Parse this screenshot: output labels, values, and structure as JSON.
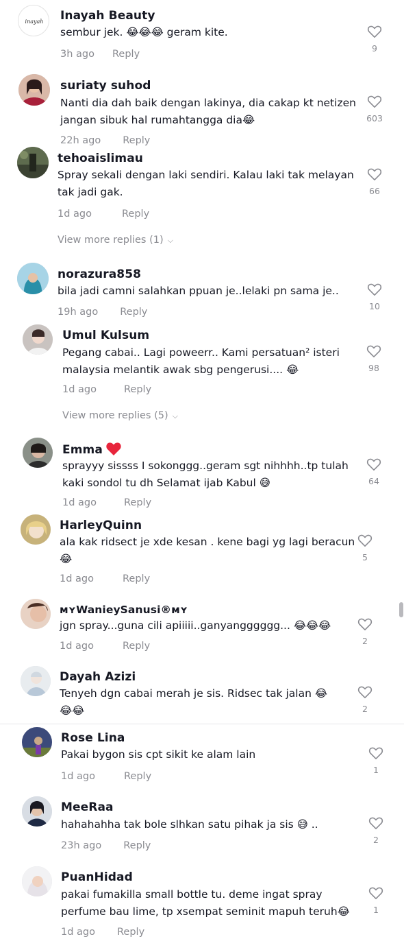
{
  "like_color": "#8a8b91",
  "accent_heart": "#e8253c",
  "comments": [
    {
      "user": "Inayah Beauty",
      "text": "sembur jek. 😂😂😂 geram kite.",
      "time": "3h ago",
      "reply": "Reply",
      "likes": "9"
    },
    {
      "user": "suriaty suhod",
      "text": "Nanti dia dah baik dengan lakinya, dia cakap kt netizen jangan sibuk hal rumahtangga dia😂",
      "time": "22h ago",
      "reply": "Reply",
      "likes": "603"
    },
    {
      "user": "tehoaislimau",
      "text": "Spray sekali dengan laki sendiri. Kalau laki tak melayan tak jadi gak.",
      "time": "1d ago",
      "reply": "Reply",
      "likes": "66",
      "view_more": "View more replies (1)"
    },
    {
      "user": "norazura858",
      "text": "bila jadi camni salahkan ppuan je..lelaki pn sama je..",
      "time": "19h ago",
      "reply": "Reply",
      "likes": "10"
    },
    {
      "user": "Umul Kulsum",
      "text": "Pegang cabai.. Lagi poweerr.. Kami persatuan² isteri malaysia melantik awak sbg pengerusi.... 😂",
      "time": "1d ago",
      "reply": "Reply",
      "likes": "98",
      "view_more": "View more replies (5)"
    },
    {
      "user": "Emma",
      "text": "sprayyy sissss I sokonggg..geram sgt nihhhh..tp tulah kaki sondol tu dh Selamat ijab Kabul 😅",
      "time": "1d ago",
      "reply": "Reply",
      "likes": "64"
    },
    {
      "user": "HarleyQuinn",
      "text": "ala kak ridsect je xde kesan . kene bagi yg lagi beracun 😂",
      "time": "1d ago",
      "reply": "Reply",
      "likes": "5"
    },
    {
      "user": "ᴍʏWanieySanusi®ᴍʏ",
      "text": "jgn spray...guna cili apiiiii..ganyangggggg... 😂😂😂",
      "time": "1d ago",
      "reply": "Reply",
      "likes": "2"
    },
    {
      "user": "Dayah Azizi",
      "text": "Tenyeh dgn cabai merah je sis. Ridsec tak jalan 😂\n😂😂",
      "time": "1d ago",
      "reply": "Reply",
      "likes": "2"
    },
    {
      "user": "Rose Lina",
      "text": "Pakai bygon sis cpt sikit ke alam lain",
      "time": "1d ago",
      "reply": "Reply",
      "likes": "1"
    },
    {
      "user": "MeeRaa",
      "text": "hahahahha tak bole slhkan satu pihak ja sis 😅 ..",
      "time": "23h ago",
      "reply": "Reply",
      "likes": "2"
    },
    {
      "user": "PuanHidad",
      "text": "pakai fumakilla small bottle tu. deme ingat spray perfume bau lime, tp xsempat seminit mapuh teruh😂",
      "time": "1d ago",
      "reply": "Reply",
      "likes": "1"
    }
  ]
}
